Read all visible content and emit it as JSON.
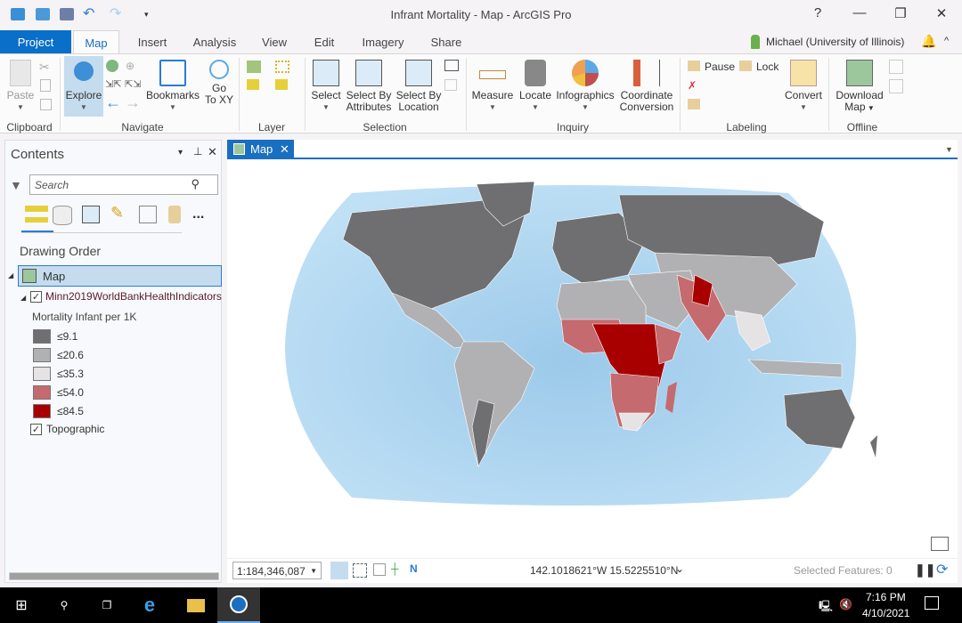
{
  "window": {
    "title": "Infrant Mortality - Map - ArcGIS Pro",
    "help": "?",
    "minimize": "—",
    "restore": "❐",
    "close": "✕"
  },
  "tabs": [
    {
      "label": "Project"
    },
    {
      "label": "Map"
    },
    {
      "label": "Insert"
    },
    {
      "label": "Analysis"
    },
    {
      "label": "View"
    },
    {
      "label": "Edit"
    },
    {
      "label": "Imagery"
    },
    {
      "label": "Share"
    }
  ],
  "user": {
    "name": "Michael (University of Illinois)"
  },
  "ribbon": {
    "clipboard": {
      "paste": "Paste",
      "group": "Clipboard"
    },
    "navigate": {
      "explore": "Explore",
      "bookmarks": "Bookmarks",
      "goto1": "Go",
      "goto2": "To XY",
      "group": "Navigate"
    },
    "layer": {
      "group": "Layer"
    },
    "selection": {
      "select": "Select",
      "sba1": "Select By",
      "sba2": "Attributes",
      "sbl1": "Select By",
      "sbl2": "Location",
      "group": "Selection"
    },
    "inquiry": {
      "measure": "Measure",
      "locate": "Locate",
      "infographics": "Infographics",
      "cc1": "Coordinate",
      "cc2": "Conversion",
      "group": "Inquiry"
    },
    "labeling": {
      "pause": "Pause",
      "lock": "Lock",
      "convert": "Convert",
      "group": "Labeling"
    },
    "offline": {
      "dl1": "Download",
      "dl2": "Map",
      "group": "Offline"
    }
  },
  "contents": {
    "title": "Contents",
    "search_placeholder": "Search",
    "section": "Drawing Order",
    "map": "Map",
    "layer": "Minn2019WorldBankHealthIndicators",
    "field": "Mortality Infant per 1K",
    "legend": [
      {
        "label": "≤9.1",
        "color": "#6f6e71"
      },
      {
        "label": "≤20.6",
        "color": "#b1b0b2"
      },
      {
        "label": "≤35.3",
        "color": "#e6e3e5"
      },
      {
        "label": "≤54.0",
        "color": "#c56a6e"
      },
      {
        "label": "≤84.5",
        "color": "#a80000"
      }
    ],
    "basemap": "Topographic",
    "more": "..."
  },
  "map": {
    "tab": "Map",
    "tab_close": "✕"
  },
  "status": {
    "scale": "1:184,346,087",
    "coords": "142.1018621°W 15.5225510°N",
    "selected": "Selected Features: 0"
  },
  "taskbar": {
    "time": "7:16 PM",
    "date": "4/10/2021"
  }
}
